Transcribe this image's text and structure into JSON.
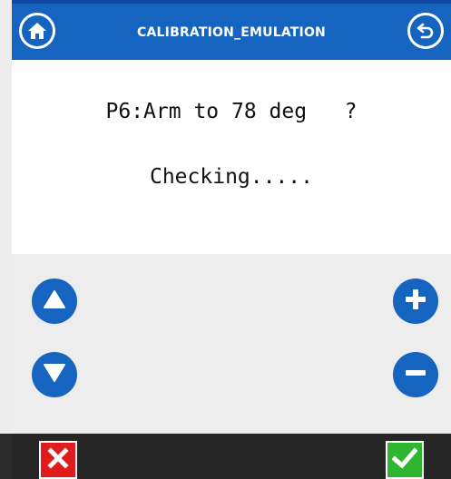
{
  "header": {
    "title": "CALIBRATION_EMULATION",
    "home_icon": "home-icon",
    "back_icon": "back-arrow-icon"
  },
  "message": {
    "prompt": "P6:Arm to 78 deg   ?",
    "status": "Checking....."
  },
  "controls": {
    "up_icon": "triangle-up-icon",
    "down_icon": "triangle-down-icon",
    "plus_icon": "plus-icon",
    "minus_icon": "minus-icon"
  },
  "footer": {
    "cancel_icon": "x-mark-icon",
    "confirm_icon": "check-mark-icon"
  },
  "colors": {
    "header_blue": "#1565c0",
    "button_blue": "#1565c0",
    "cancel_red": "#e01b1b",
    "confirm_green": "#2fb52f",
    "footer_dark": "#262626",
    "controls_bg": "#ededed"
  }
}
